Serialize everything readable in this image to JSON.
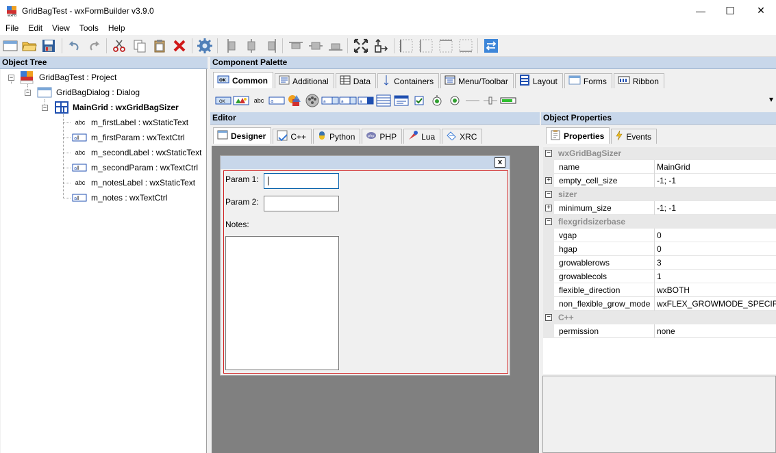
{
  "window": {
    "title": "GridBagTest - wxFormBuilder v3.9.0",
    "minimize": "—",
    "maximize": "☐",
    "close": "✕"
  },
  "menu": [
    "File",
    "Edit",
    "View",
    "Tools",
    "Help"
  ],
  "toolbar_icons": [
    "new-icon",
    "open-icon",
    "save-icon",
    "undo-icon",
    "redo-icon",
    "cut-icon",
    "copy-icon",
    "paste-icon",
    "delete-icon",
    "generate-code-icon",
    "align-left-icon",
    "align-center-icon",
    "align-right-icon",
    "align-top-icon",
    "align-middle-icon",
    "align-bottom-icon",
    "expand-icon",
    "stretch-icon",
    "border-left-icon",
    "border-right-icon",
    "border-top-icon",
    "border-bottom-icon",
    "toggle-orientation-icon"
  ],
  "object_tree": {
    "title": "Object Tree",
    "nodes": [
      {
        "label": "GridBagTest : Project",
        "icon": "project-icon"
      },
      {
        "label": "GridBagDialog : Dialog",
        "icon": "dialog-icon"
      },
      {
        "label": "MainGrid : wxGridBagSizer",
        "icon": "gridbagsizer-icon"
      },
      {
        "label": "m_firstLabel : wxStaticText",
        "icon": "abc"
      },
      {
        "label": "m_firstParam : wxTextCtrl",
        "icon": "textctrl-icon"
      },
      {
        "label": "m_secondLabel : wxStaticText",
        "icon": "abc"
      },
      {
        "label": "m_secondParam : wxTextCtrl",
        "icon": "textctrl-icon"
      },
      {
        "label": "m_notesLabel : wxStaticText",
        "icon": "abc"
      },
      {
        "label": "m_notes : wxTextCtrl",
        "icon": "textctrl-icon"
      }
    ]
  },
  "palette": {
    "title": "Component Palette",
    "tabs": [
      "Common",
      "Additional",
      "Data",
      "Containers",
      "Menu/Toolbar",
      "Layout",
      "Forms",
      "Ribbon"
    ],
    "icon_text": "abc",
    "overflow": "▾"
  },
  "editor": {
    "title": "Editor",
    "tabs": [
      "Designer",
      "C++",
      "Python",
      "PHP",
      "Lua",
      "XRC"
    ],
    "dialog": {
      "close": "x",
      "param1": "Param 1:",
      "param2": "Param 2:",
      "notes": "Notes:"
    }
  },
  "object_properties": {
    "title": "Object Properties",
    "tabs": [
      "Properties",
      "Events"
    ],
    "rows": [
      {
        "type": "category",
        "name": "wxGridBagSizer",
        "box": "−"
      },
      {
        "type": "prop",
        "name": "name",
        "value": "MainGrid",
        "box": ""
      },
      {
        "type": "prop",
        "name": "empty_cell_size",
        "value": "-1; -1",
        "box": "+"
      },
      {
        "type": "category",
        "name": "sizer",
        "box": "−"
      },
      {
        "type": "prop",
        "name": "minimum_size",
        "value": "-1; -1",
        "box": "+"
      },
      {
        "type": "category",
        "name": "flexgridsizerbase",
        "box": "−"
      },
      {
        "type": "prop",
        "name": "vgap",
        "value": "0",
        "box": ""
      },
      {
        "type": "prop",
        "name": "hgap",
        "value": "0",
        "box": ""
      },
      {
        "type": "prop",
        "name": "growablerows",
        "value": "3",
        "box": ""
      },
      {
        "type": "prop",
        "name": "growablecols",
        "value": "1",
        "box": ""
      },
      {
        "type": "prop",
        "name": "flexible_direction",
        "value": "wxBOTH",
        "box": ""
      },
      {
        "type": "prop",
        "name": "non_flexible_grow_mode",
        "value": "wxFLEX_GROWMODE_SPECIFIED",
        "box": ""
      },
      {
        "type": "category",
        "name": "C++",
        "box": "−"
      },
      {
        "type": "prop",
        "name": "permission",
        "value": "none",
        "box": ""
      }
    ]
  }
}
